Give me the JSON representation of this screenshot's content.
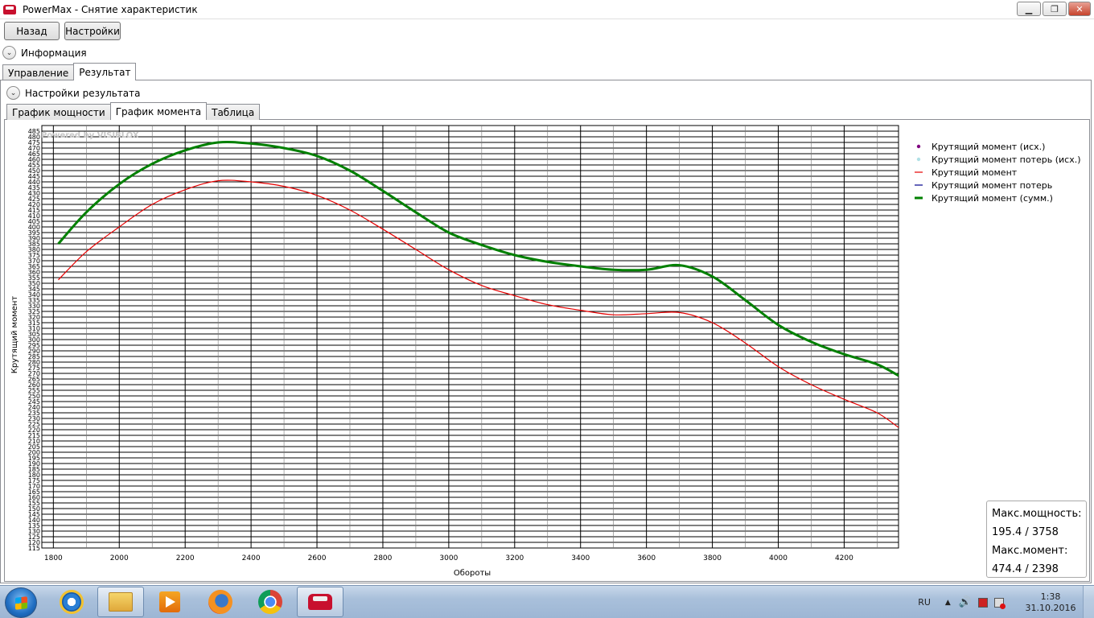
{
  "window": {
    "title": "PowerMax - Снятие характеристик"
  },
  "toolbar": {
    "back_label": "Назад",
    "settings_label": "Настройки"
  },
  "info_expander": {
    "label": "Информация"
  },
  "main_tabs": [
    {
      "label": "Управление"
    },
    {
      "label": "Результат"
    }
  ],
  "result_settings_expander": {
    "label": "Настройки результата"
  },
  "result_tabs": [
    {
      "label": "График мощности"
    },
    {
      "label": "График момента"
    },
    {
      "label": "Таблица"
    }
  ],
  "watermark": "Powered by VISIBLOX",
  "chart_data": {
    "type": "line",
    "xlabel": "Обороты",
    "ylabel": "Крутящий момент",
    "xlim": [
      1765,
      4365
    ],
    "ylim": [
      115,
      490
    ],
    "x_ticks": [
      1800,
      2000,
      2200,
      2400,
      2600,
      2800,
      3000,
      3200,
      3400,
      3600,
      3800,
      4000,
      4200
    ],
    "y_tick_labels": [
      "485",
      "480",
      "475",
      "470",
      "465",
      "460",
      "455",
      "450",
      "445",
      "440",
      "435",
      "430",
      "425",
      "420",
      "415",
      "410",
      "405",
      "400",
      "395",
      "390",
      "385",
      "380",
      "375",
      "370",
      "365",
      "360",
      "355",
      "350",
      "345",
      "340",
      "335",
      "330",
      "325",
      "320",
      "315",
      "310",
      "305",
      "300",
      "295",
      "290",
      "285",
      "280",
      "275",
      "270",
      "265",
      "260",
      "255",
      "250",
      "245",
      "240",
      "235",
      "230",
      "225",
      "220",
      "215",
      "210",
      "205",
      "200",
      "195",
      "190",
      "185",
      "180",
      "175",
      "170",
      "165",
      "160",
      "155",
      "150",
      "145",
      "140",
      "135",
      "130",
      "125",
      "120",
      "115"
    ],
    "grid": true,
    "legend_position": "right",
    "legend": [
      {
        "name": "Крутящий момент (исх.)",
        "color": "#800080",
        "marker": "dot"
      },
      {
        "name": "Крутящий момент потерь (исх.)",
        "color": "#b0e0e6",
        "marker": "dot"
      },
      {
        "name": "Крутящий момент",
        "color": "#e60000",
        "marker": "line"
      },
      {
        "name": "Крутящий момент потерь",
        "color": "#00008b",
        "marker": "line"
      },
      {
        "name": "Крутящий момент (сумм.)",
        "color": "#008000",
        "marker": "thick-line"
      }
    ],
    "series": [
      {
        "name": "Крутящий момент",
        "color": "#e60000",
        "x": [
          1815,
          1900,
          2000,
          2100,
          2200,
          2300,
          2400,
          2500,
          2600,
          2700,
          2800,
          2900,
          3000,
          3100,
          3200,
          3300,
          3400,
          3500,
          3600,
          3700,
          3800,
          3900,
          4000,
          4100,
          4200,
          4300,
          4365
        ],
        "y": [
          353,
          378,
          400,
          420,
          433,
          441,
          440,
          436,
          428,
          415,
          398,
          380,
          362,
          348,
          339,
          331,
          326,
          322,
          323,
          324,
          315,
          297,
          276,
          260,
          247,
          235,
          222
        ]
      },
      {
        "name": "Крутящий момент (сумм.)",
        "color": "#008000",
        "x": [
          1815,
          1900,
          2000,
          2100,
          2200,
          2300,
          2400,
          2500,
          2600,
          2700,
          2800,
          2900,
          3000,
          3100,
          3200,
          3300,
          3400,
          3500,
          3600,
          3700,
          3800,
          3900,
          4000,
          4100,
          4200,
          4300,
          4365
        ],
        "y": [
          385,
          413,
          438,
          456,
          468,
          475,
          474,
          470,
          463,
          450,
          432,
          413,
          395,
          384,
          375,
          369,
          365,
          362,
          362,
          366,
          356,
          335,
          313,
          298,
          287,
          278,
          268
        ]
      }
    ]
  },
  "stats": {
    "max_power_label": "Макс.мощность:",
    "max_power_value": "195.4 / 3758",
    "max_torque_label": "Макс.момент:",
    "max_torque_value": "474.4 / 2398"
  },
  "taskbar": {
    "language": "RU",
    "time": "1:38",
    "date": "31.10.2016"
  }
}
